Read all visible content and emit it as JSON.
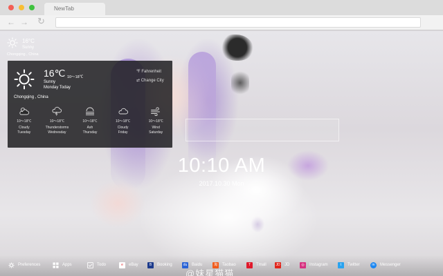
{
  "browser": {
    "tab_title": "NewTab",
    "nav_back": "←",
    "nav_forward": "→",
    "nav_reload": "↻"
  },
  "weather_mini": {
    "temp": "16°C",
    "condition": "Sunny",
    "location": "Chongqing , China",
    "icon": "sun-icon"
  },
  "weather_panel": {
    "temp": "16℃",
    "range": "10～18℃",
    "condition": "Sunny",
    "day": "Monday Today",
    "unit_toggle": "℉ Fahrenheit",
    "change_city": "⇄ Change City",
    "location": "Chongqing , China",
    "forecast": [
      {
        "icon": "cloudy-sun-icon",
        "range": "10～18℃",
        "condition": "Cloudy",
        "day": "Tuesday"
      },
      {
        "icon": "thunderstorm-icon",
        "range": "10～18℃",
        "condition": "Thunderstorms",
        "day": "Wednesday"
      },
      {
        "icon": "ash-icon",
        "range": "10～18℃",
        "condition": "Ash",
        "day": "Thursday"
      },
      {
        "icon": "cloud-icon",
        "range": "10～18℃",
        "condition": "Cloudy",
        "day": "Friday"
      },
      {
        "icon": "wind-icon",
        "range": "10～18℃",
        "condition": "Wind",
        "day": "Saturday"
      }
    ]
  },
  "clock": {
    "time": "10:10 AM",
    "date": "2017.10.30 Mon"
  },
  "bottom_bar": {
    "items": [
      {
        "label": "Preferences",
        "icon": "gear-icon",
        "color": "transparent"
      },
      {
        "label": "Apps",
        "icon": "grid-icon",
        "color": "transparent"
      },
      {
        "label": "Todo",
        "icon": "checkbox-icon",
        "color": "transparent"
      },
      {
        "label": "eBay",
        "icon": "ebay-icon",
        "color": "#ffffff"
      },
      {
        "label": "Booking",
        "icon": "booking-icon",
        "color": "#1d3b8c"
      },
      {
        "label": "Baidu",
        "icon": "baidu-icon",
        "color": "#2a63d6"
      },
      {
        "label": "Taobao",
        "icon": "taobao-icon",
        "color": "#f05a1a"
      },
      {
        "label": "Tmall",
        "icon": "tmall-icon",
        "color": "#e0192b"
      },
      {
        "label": "JD",
        "icon": "jd-icon",
        "color": "#e1251b"
      },
      {
        "label": "Instagram",
        "icon": "instagram-icon",
        "color": "#d6307f"
      },
      {
        "label": "Twitter",
        "icon": "twitter-icon",
        "color": "#2aa3ef"
      },
      {
        "label": "Messenger",
        "icon": "messenger-icon",
        "color": "#1b86f2"
      }
    ]
  },
  "watermark": "@妹星猫猫"
}
